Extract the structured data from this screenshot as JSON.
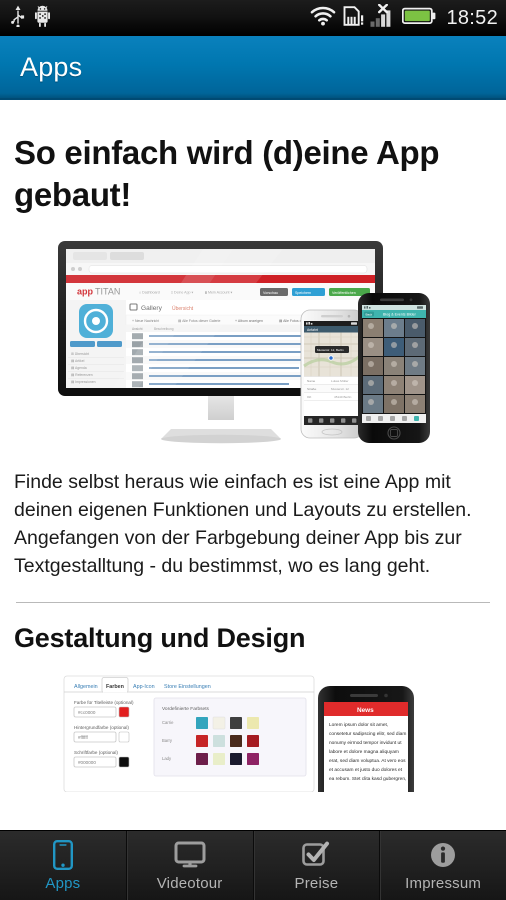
{
  "status_bar": {
    "icons_left": [
      "usb-icon",
      "android-debug-icon"
    ],
    "icons_right": [
      "wifi-icon",
      "sim-card-alert-icon",
      "signal-no-service-icon",
      "battery-icon"
    ],
    "time": "18:52"
  },
  "action_bar": {
    "title": "Apps",
    "background_color": "#0077b0"
  },
  "content": {
    "heading": "So einfach wird (d)eine App gebaut!",
    "hero_image": {
      "name": "apptitan-devices-hero-image",
      "alt": "Desktop monitor showing appTITAN admin panel with an Android phone and an iPhone",
      "desktop": {
        "brand": "appTITAN",
        "page_title": "Gallery",
        "page_subtitle": "Übersicht",
        "nav_items": [
          "Dashboard",
          "Deine App",
          "Mein Account"
        ],
        "buttons": [
          "Vorschau",
          "Speichern",
          "Veröffentlichen"
        ],
        "toolbar_items": [
          "Neue Nachricht",
          "Alle Fotos dieser Galerie",
          "Album anzeigen",
          "Alle Fotos dieser Galerie",
          "Einstellungen"
        ],
        "sidebar_items": [
          "Übersicht",
          "Artikel",
          "Agenda",
          "Referenzen",
          "Impressionen",
          "Videos",
          "Termine"
        ],
        "sidebar_tabs": [
          "Grundlagen",
          "Reihenfolge"
        ],
        "table_headers": [
          "Ansicht",
          "Beschreibung"
        ],
        "row_count": 7
      },
      "phone_android": {
        "screen": "map-view"
      },
      "phone_iphone": {
        "screen": "photo-gallery-grid"
      }
    },
    "paragraph": "Finde selbst heraus wie einfach es ist eine App mit deinen eigenen Funktionen und Layouts zu erstellen. Angefangen von der Farbgebung deiner App bis zur Textgestalltung - du bestimmst, wo es lang geht.",
    "section_heading": "Gestaltung und Design",
    "section_image": {
      "name": "design-settings-image",
      "alt": "appTITAN colour settings panel next to an iPhone preview",
      "tabs": [
        "Allgemein",
        "Farben",
        "App-Icon",
        "Store Einstellungen"
      ],
      "active_tab": "Farben",
      "fields": [
        {
          "label": "Farbe für Titelleiste (optional)",
          "value": "#cc0000",
          "swatch": "#cc0000"
        },
        {
          "label": "Hintergrundfarbe (optional)",
          "value": "#ffffff",
          "swatch": "#ffffff"
        },
        {
          "label": "Schriftfarbe (optional)",
          "value": "#000000",
          "swatch": "#000000"
        }
      ],
      "presets_title": "Vordefinierte Farbsets",
      "presets": [
        {
          "name": "Carrie",
          "colors": [
            "#33a5bd",
            "#f3f1e6",
            "#3f3f3f",
            "#ece8ae"
          ]
        },
        {
          "name": "Barry",
          "colors": [
            "#c62526",
            "#cde0de",
            "#4a2b1c",
            "#a51c22"
          ]
        },
        {
          "name": "Lady",
          "colors": [
            "#6d1f4a",
            "#e9eec9",
            "#1b1b2e",
            "#8e2364"
          ]
        }
      ],
      "phone_preview": {
        "header": "News",
        "header_color": "#e02b2b",
        "body": "Lorem ipsum dolor sit amet, consetetur sadipscing elitr, sed diam nonumy eirmod tempor invidunt ut labore et dolore magna aliquyam erat, sed diam voluptua. At vero eos et accusam et justo duo dolores et ea rebum. Stet clita kasd gubergren."
      }
    }
  },
  "tab_bar": {
    "active_color": "#2196c4",
    "inactive_color": "#b4b4b4",
    "tabs": [
      {
        "label": "Apps",
        "icon": "mobile-phone-icon",
        "active": true
      },
      {
        "label": "Videotour",
        "icon": "monitor-icon",
        "active": false
      },
      {
        "label": "Preise",
        "icon": "checkbox-check-icon",
        "active": false
      },
      {
        "label": "Impressum",
        "icon": "info-circle-icon",
        "active": false
      }
    ]
  }
}
